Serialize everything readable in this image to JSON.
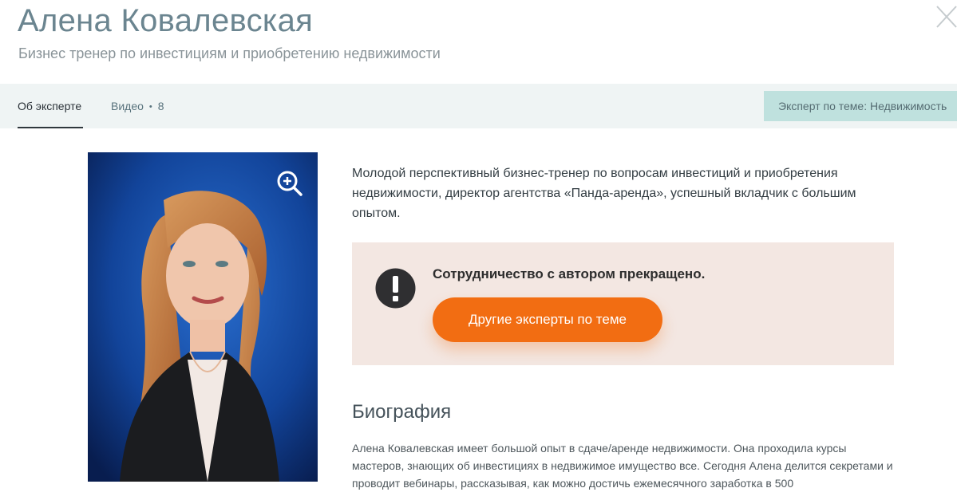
{
  "expert": {
    "name": "Алена Ковалевская",
    "subtitle": "Бизнес тренер по инвестициям и приобретению недвижимости"
  },
  "tabs": [
    {
      "label": "Об эксперте",
      "active": true
    },
    {
      "label": "Видео",
      "separator": "•",
      "count": "8",
      "active": false
    }
  ],
  "topic_badge": "Эксперт по теме: Недвижимость",
  "intro": "Молодой перспективный бизнес-тренер по вопросам инвестиций и приобретения недвижимости, директор агентства «Панда-аренда», успешный вкладчик с большим опытом.",
  "notice": {
    "text": "Сотрудничество с автором прекращено.",
    "button_label": "Другие эксперты по теме"
  },
  "biography": {
    "title": "Биография",
    "text": "Алена Ковалевская имеет большой опыт в сдаче/аренде недвижимости. Она проходила курсы мастеров, знающих об инвестициях в недвижимое имущество все. Сегодня Алена делится секретами и проводит вебинары, рассказывая, как можно достичь ежемесячного заработка в 500"
  },
  "icons": {
    "close": "close-icon",
    "zoom": "zoom-in-icon",
    "notice": "exclamation-icon"
  },
  "colors": {
    "accent_button": "#f26d12",
    "badge_bg": "#bfe1de",
    "tabs_bg": "#eff4f4",
    "notice_bg": "#f3e7e2"
  }
}
